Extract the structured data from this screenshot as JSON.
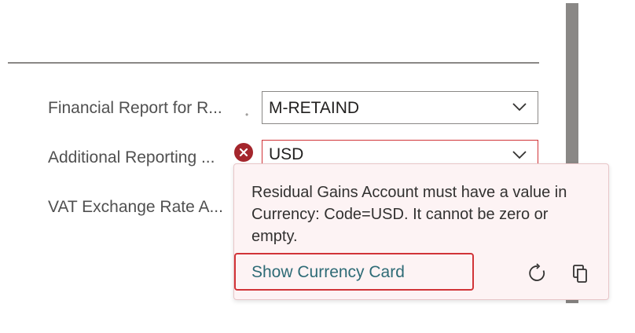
{
  "fields": [
    {
      "label": "Financial Report for R...",
      "value": "M-RETAIND"
    },
    {
      "label": "Additional Reporting ...",
      "value": "USD"
    },
    {
      "label": "VAT Exchange Rate A..."
    }
  ],
  "error_callout": {
    "message": "Residual Gains Account must have a value in Currency: Code=USD. It cannot be zero or empty.",
    "action_label": "Show Currency Card",
    "icons": [
      "refresh-icon",
      "copy-icon"
    ]
  },
  "colors": {
    "error": "#d13438",
    "error_icon": "#a4262c",
    "callout_bg": "#fdf3f4",
    "link": "#2e6b76"
  }
}
